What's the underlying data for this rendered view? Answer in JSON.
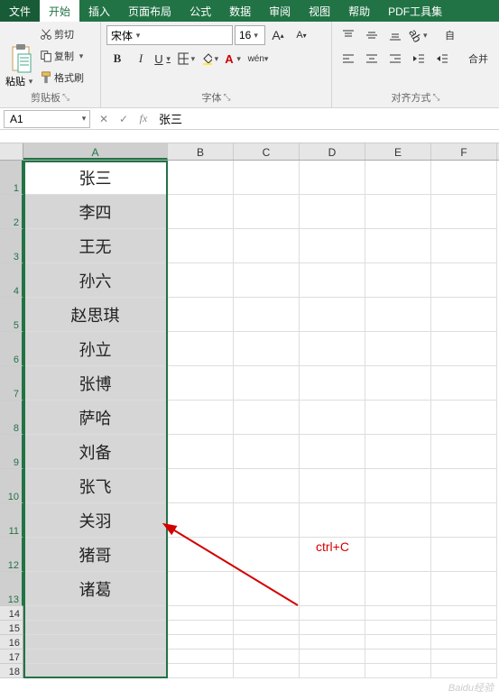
{
  "menu": {
    "file": "文件",
    "tabs": [
      "开始",
      "插入",
      "页面布局",
      "公式",
      "数据",
      "审阅",
      "视图",
      "帮助",
      "PDF工具集"
    ]
  },
  "ribbon": {
    "clipboard": {
      "label": "剪贴板",
      "paste": "粘贴",
      "cut": "剪切",
      "copy": "复制",
      "painter": "格式刷"
    },
    "font": {
      "label": "字体",
      "name": "宋体",
      "size": "16",
      "bold": "B",
      "italic": "I",
      "underline": "U",
      "wen": "wén"
    },
    "align": {
      "label": "对齐方式",
      "wrap": "自",
      "merge": "合并"
    }
  },
  "namebox": "A1",
  "formula": "张三",
  "columns": [
    "A",
    "B",
    "C",
    "D",
    "E",
    "F"
  ],
  "rows": [
    {
      "n": 1,
      "a": "张三",
      "active": true
    },
    {
      "n": 2,
      "a": "李四"
    },
    {
      "n": 3,
      "a": "王无"
    },
    {
      "n": 4,
      "a": "孙六"
    },
    {
      "n": 5,
      "a": "赵思琪"
    },
    {
      "n": 6,
      "a": "孙立"
    },
    {
      "n": 7,
      "a": "张博"
    },
    {
      "n": 8,
      "a": "萨哈"
    },
    {
      "n": 9,
      "a": "刘备"
    },
    {
      "n": 10,
      "a": "张飞"
    },
    {
      "n": 11,
      "a": "关羽"
    },
    {
      "n": 12,
      "a": "猪哥"
    },
    {
      "n": 13,
      "a": "诸葛"
    }
  ],
  "extra_rows": [
    14,
    15,
    16,
    17,
    18
  ],
  "annotation": "ctrl+C",
  "watermark": "Baidu经验"
}
